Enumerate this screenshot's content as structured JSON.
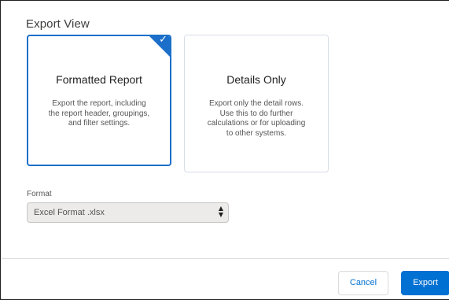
{
  "section_title": "Export View",
  "options": [
    {
      "title": "Formatted Report",
      "description_lines": [
        "Export the report, including",
        "the report header, groupings,",
        "and filter settings."
      ],
      "selected": true
    },
    {
      "title": "Details Only",
      "description_lines": [
        "Export only the detail rows.",
        "Use this to do further",
        "calculations or for uploading",
        "to other systems."
      ],
      "selected": false
    }
  ],
  "format": {
    "label": "Format",
    "selected_value": "Excel Format .xlsx"
  },
  "footer": {
    "cancel_label": "Cancel",
    "export_label": "Export"
  },
  "icons": {
    "selected_check": "checkmark-icon",
    "select_arrows": "updown-arrows-icon"
  },
  "colors": {
    "accent": "#1b6fc9",
    "primary_button": "#0070d2",
    "select_background": "#ecebea"
  }
}
